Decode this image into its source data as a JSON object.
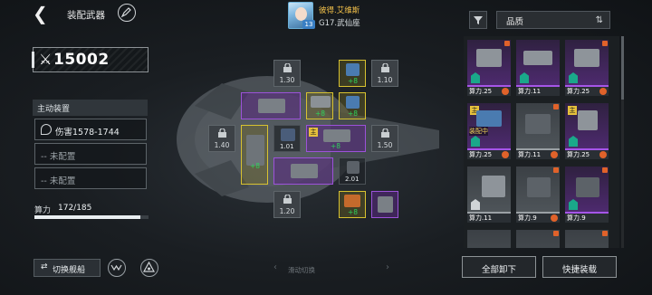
{
  "header": {
    "title": "装配武器",
    "pilot": {
      "name": "彼得.艾维斯",
      "level": "13",
      "ship": "G17.武仙座"
    },
    "sort_label": "品质"
  },
  "left_panel": {
    "power_value": "15002",
    "active_title": "主动装置",
    "active_slots": [
      "伤害1578-1744",
      "-- 未配置",
      "-- 未配置"
    ],
    "capacity_label": "算力",
    "capacity_used": 172,
    "capacity_max": 185,
    "capacity_text": "172/185",
    "capacity_fraction": 0.93
  },
  "grid": {
    "locked_values": [
      "1.30",
      "1.10",
      "1.40",
      "1.50",
      "1.20"
    ],
    "module_values": [
      "1.01",
      "2.01"
    ],
    "plus_labels": [
      "+8",
      "+8",
      "+8",
      "+8",
      "+8",
      "+8",
      "+8"
    ],
    "main_tag": "主"
  },
  "inventory": {
    "cards": [
      {
        "power": "算力.25",
        "rarity": "purple"
      },
      {
        "power": "算力.11",
        "rarity": "purple"
      },
      {
        "power": "算力.25",
        "rarity": "purple"
      },
      {
        "power": "算力.25",
        "rarity": "purple",
        "status": "装配中"
      },
      {
        "power": "算力.11",
        "rarity": "gray"
      },
      {
        "power": "算力.25",
        "rarity": "purple"
      },
      {
        "power": "算力.11",
        "rarity": "gray"
      },
      {
        "power": "算力.9",
        "rarity": "gray"
      },
      {
        "power": "算力.9",
        "rarity": "purple"
      }
    ]
  },
  "footer": {
    "switch_ship": "切换舰船",
    "swipe_hint": "滑动切换",
    "unequip_all": "全部卸下",
    "quick_equip": "快捷装载"
  },
  "colors": {
    "rare_purple": "#9c52d9",
    "main_yellow": "#d8c230",
    "plus_green": "#2ed35b",
    "alert_orange": "#e0622a"
  },
  "icons": [
    "back-icon",
    "edit-icon",
    "filter-icon",
    "sort-icon",
    "lock-icon",
    "switch-icon",
    "fleet-icon",
    "target-icon"
  ]
}
